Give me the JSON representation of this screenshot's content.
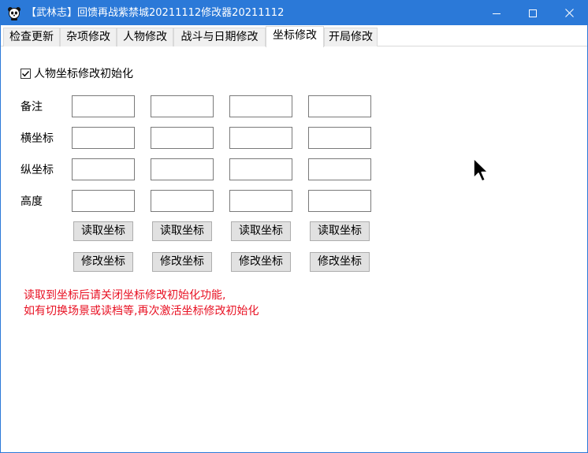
{
  "window": {
    "title": "【武林志】回馈再战紫禁城20211112修改器20211112"
  },
  "icons": {
    "app": "panda-app-icon",
    "minimize": "minimize-icon",
    "maximize": "maximize-icon",
    "close": "close-icon",
    "cursor": "mouse-pointer-icon"
  },
  "tabs": [
    {
      "label": "检查更新"
    },
    {
      "label": "杂项修改"
    },
    {
      "label": "人物修改"
    },
    {
      "label": "战斗与日期修改"
    },
    {
      "label": "坐标修改",
      "active": true
    },
    {
      "label": "开局修改"
    }
  ],
  "coords": {
    "init_checkbox": {
      "label": "人物坐标修改初始化",
      "checked": true
    },
    "rows": [
      {
        "label": "备注",
        "values": [
          "",
          "",
          "",
          ""
        ]
      },
      {
        "label": "横坐标",
        "values": [
          "",
          "",
          "",
          ""
        ]
      },
      {
        "label": "纵坐标",
        "values": [
          "",
          "",
          "",
          ""
        ]
      },
      {
        "label": "高度",
        "values": [
          "",
          "",
          "",
          ""
        ]
      }
    ],
    "read_buttons": [
      "读取坐标",
      "读取坐标",
      "读取坐标",
      "读取坐标"
    ],
    "modify_buttons": [
      "修改坐标",
      "修改坐标",
      "修改坐标",
      "修改坐标"
    ],
    "notice_lines": [
      "读取到坐标后请关闭坐标修改初始化功能,",
      "如有切换场景或读档等,再次激活坐标修改初始化"
    ],
    "notice_color": "#e81123"
  },
  "colors": {
    "titlebar": "#2b79d8",
    "button_face": "#e1e1e1"
  }
}
